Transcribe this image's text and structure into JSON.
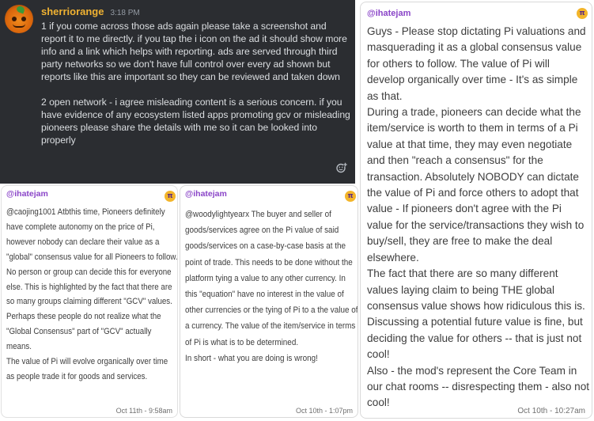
{
  "discord": {
    "username": "sherriorange",
    "timestamp": "3:18 PM",
    "paragraphs": [
      "1 if you come across those ads again please take a screenshot and report it to me directly. if you tap the i icon on the ad it should show more info and a link which helps with reporting. ads are served through third party networks so we don't have full control over every ad shown but reports like this are important so they can be reviewed and taken down",
      "2 open network -  i agree misleading content is a serious concern. if you have evidence of any ecosystem listed apps promoting gcv or misleading pioneers please share the details with me so it can be looked into properly"
    ],
    "reaction_icon": "add-reaction-icon"
  },
  "cards": {
    "left": {
      "handle": "@ihatejam",
      "badge": "π",
      "paragraphs": [
        "@caojing1001 Atbthis time, Pioneers definitely have complete autonomy on the price of Pi, however nobody can declare their value as a \"global\" consensus value for all Pioneers to follow. No person or group can decide this for everyone else. This is highlighted by the fact that there are so many groups claiming different \"GCV\" values. Perhaps these people do not realize what the \"Global Consensus\" part of \"GCV\" actually means.",
        "The value of Pi will evolve organically over time as people trade it for goods and services."
      ],
      "timestamp": "Oct 11th - 9:58am"
    },
    "middle": {
      "handle": "@ihatejam",
      "badge": "π",
      "paragraphs": [
        "@woodylightyearx The buyer and seller of goods/services agree on the Pi value of said goods/services on a case-by-case basis at the point of trade. This needs to be done without the platform tying a value to any other currency. In this \"equation\" have no interest in the value of other currencies or the tying of Pi to a the value of a currency. The value of the item/service in terms of Pi is what is to be determined.",
        "In short - what you are doing is wrong!"
      ],
      "timestamp": "Oct 10th - 1:07pm"
    },
    "right": {
      "handle": "@ihatejam",
      "badge": "π",
      "paragraphs": [
        "Guys - Please stop dictating Pi valuations and masquerading it as a global consensus value for others to follow. The value of Pi will develop organically over time - It's as simple as that.",
        "During a trade, pioneers can decide what the item/service is worth to them in terms of a Pi value at that time, they may even negotiate and then \"reach a consensus\" for the transaction. Absolutely NOBODY can dictate the value of Pi and force others to adopt that value - If pioneers don't agree with the Pi value for the service/transactions they wish to buy/sell, they are free to make the deal elsewhere.",
        "The fact that there are so many different values laying claim to being THE global consensus value shows how ridiculous this is. Discussing a potential future value is fine, but deciding the value for others -- that is just not cool!",
        "Also - the mod's represent the Core Team in our chat rooms -- disrespecting them - also not cool!"
      ],
      "timestamp": "Oct 10th - 10:27am"
    }
  },
  "colors": {
    "discord_bg": "#2b2d31",
    "username": "#f0b232",
    "handle": "#8a45c8",
    "pi_badge": "#f3b52a"
  }
}
